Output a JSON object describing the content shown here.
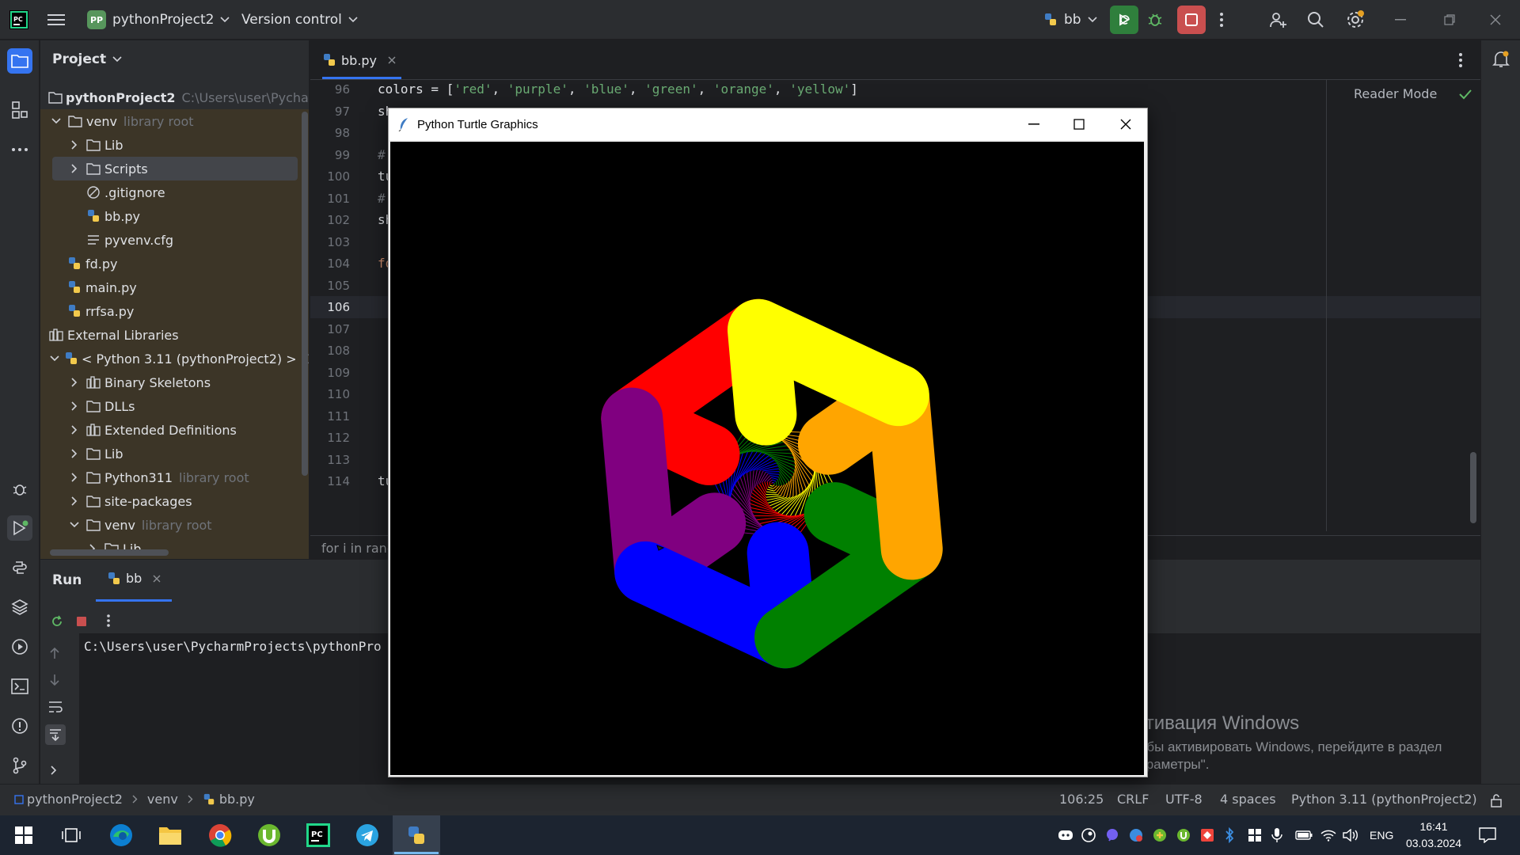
{
  "titlebar": {
    "project_badge": "PP",
    "project_name": "pythonProject2",
    "vcs_label": "Version control",
    "run_config": "bb"
  },
  "project_panel": {
    "title": "Project",
    "tree": [
      {
        "label": "pythonProject2",
        "hint": "C:\\Users\\user\\Pychar"
      },
      {
        "label": "venv",
        "hint": "library root"
      },
      {
        "label": "Lib",
        "hint": ""
      },
      {
        "label": "Scripts",
        "hint": ""
      },
      {
        "label": ".gitignore",
        "hint": ""
      },
      {
        "label": "bb.py",
        "hint": ""
      },
      {
        "label": "pyvenv.cfg",
        "hint": ""
      },
      {
        "label": "fd.py",
        "hint": ""
      },
      {
        "label": "main.py",
        "hint": ""
      },
      {
        "label": "rrfsa.py",
        "hint": ""
      },
      {
        "label": "External Libraries",
        "hint": ""
      },
      {
        "label": "< Python 3.11 (pythonProject2) >",
        "hint": "C:"
      },
      {
        "label": "Binary Skeletons",
        "hint": ""
      },
      {
        "label": "DLLs",
        "hint": ""
      },
      {
        "label": "Extended Definitions",
        "hint": ""
      },
      {
        "label": "Lib",
        "hint": ""
      },
      {
        "label": "Python311",
        "hint": "library root"
      },
      {
        "label": "site-packages",
        "hint": ""
      },
      {
        "label": "venv",
        "hint": "library root"
      },
      {
        "label": "Lib",
        "hint": ""
      }
    ]
  },
  "editor": {
    "tab_label": "bb.py",
    "reader_mode": "Reader Mode",
    "line_numbers": [
      "96",
      "97",
      "98",
      "99",
      "100",
      "101",
      "102",
      "103",
      "104",
      "105",
      "106",
      "107",
      "108",
      "109",
      "110",
      "111",
      "112",
      "113",
      "114"
    ],
    "current_line": "106",
    "code": {
      "l96_prefix": "colors = [",
      "l96_s1": "'red'",
      "l96_s2": "'purple'",
      "l96_s3": "'blue'",
      "l96_s4": "'green'",
      "l96_s5": "'orange'",
      "l96_s6": "'yellow'",
      "l96_suffix": "]",
      "l97": "sh",
      "l99": "#",
      "l100": "tu",
      "l101": "#",
      "l102": "sh",
      "l104": "fo",
      "l114": "tu"
    },
    "breadcrumb": "for i in rang"
  },
  "run_panel": {
    "title": "Run",
    "tab_label": "bb",
    "console_line": "C:\\Users\\user\\PycharmProjects\\pythonPro"
  },
  "turtle_window": {
    "title": "Python Turtle Graphics",
    "canvas_background": "#000000"
  },
  "turtle_drawing": {
    "spiral_colors": [
      "#ff0000",
      "#800080",
      "#0000ff",
      "#008000",
      "#ffa500",
      "#ffff00"
    ],
    "arms": [
      {
        "color": "red"
      },
      {
        "color": "purple"
      },
      {
        "color": "blue"
      },
      {
        "color": "green"
      },
      {
        "color": "orange"
      },
      {
        "color": "yellow"
      }
    ]
  },
  "statusbar": {
    "breadcrumb": [
      "pythonProject2",
      "venv",
      "bb.py"
    ],
    "position": "106:25",
    "line_sep": "CRLF",
    "encoding": "UTF-8",
    "indent": "4 spaces",
    "interpreter": "Python 3.11 (pythonProject2)"
  },
  "watermark": {
    "title": "Активация Windows",
    "line1": "Чтобы активировать Windows, перейдите в раздел",
    "line2": "\"Параметры\"."
  },
  "taskbar": {
    "lang": "ENG",
    "time": "16:41",
    "date": "03.03.2024"
  }
}
